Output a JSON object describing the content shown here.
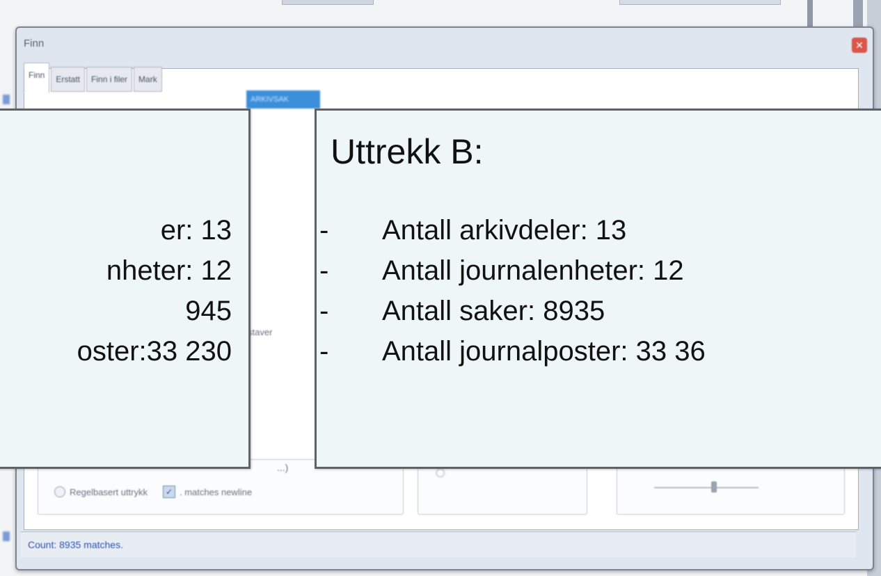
{
  "dialog": {
    "title": "Finn",
    "close_glyph": "✕",
    "tabs": [
      "Finn",
      "Erstatt",
      "Finn i filer",
      "Mark"
    ],
    "search_value": "ARKIVSAK",
    "partial_label": "staver",
    "regex_label": "Regelbasert uttrykk",
    "newline_label": ". matches newline",
    "paren_text": "...)",
    "status": "Count: 8935 matches."
  },
  "box_a": {
    "lines": [
      "er: 13",
      "nheter: 12",
      "945",
      "oster:33 230"
    ]
  },
  "box_b": {
    "title": "Uttrekk B:",
    "lines": [
      "Antall arkivdeler: 13",
      "Antall journalenheter: 12",
      "Antall saker: 8935",
      "Antall journalposter: 33 36"
    ],
    "bullet": "-"
  }
}
